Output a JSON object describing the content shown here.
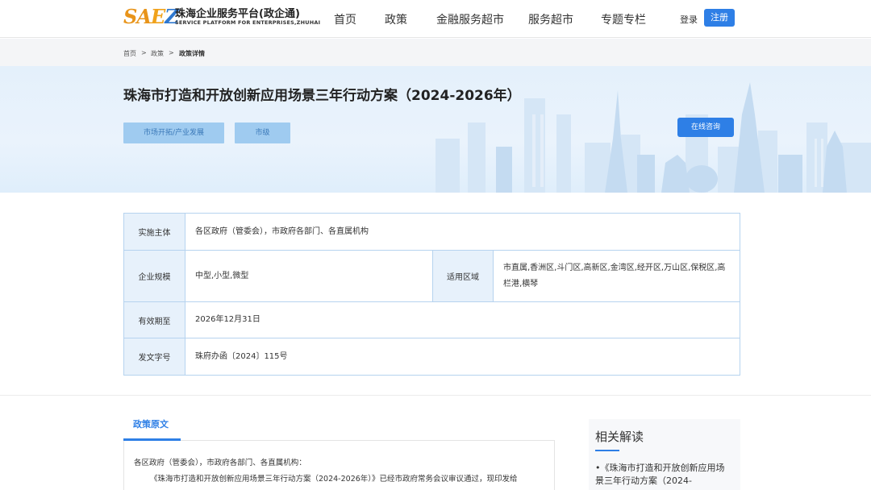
{
  "header": {
    "logo_mark": "SAEZ",
    "logo_cn": "珠海企业服务平台(政企通)",
    "logo_en": "SERVICE PLATFORM FOR ENTERPRISES,ZHUHAI",
    "nav": [
      "首页",
      "政策",
      "金融服务超市",
      "服务超市",
      "专题专栏"
    ],
    "login": "登录",
    "register": "注册"
  },
  "breadcrumb": {
    "items": [
      "首页",
      "政策",
      "政策详情"
    ],
    "separator": ">"
  },
  "banner": {
    "title": "珠海市打造和开放创新应用场景三年行动方案（2024-2026年）",
    "tags": [
      "市场开拓/产业发展",
      "市级"
    ],
    "consult_button": "在线咨询"
  },
  "info": {
    "implementer_label": "实施主体",
    "implementer_value": "各区政府（管委会），市政府各部门、各直属机构",
    "scale_label": "企业规模",
    "scale_value": "中型,小型,微型",
    "region_label": "适用区域",
    "region_value": "市直属,香洲区,斗门区,高新区,金湾区,经开区,万山区,保税区,高栏港,横琴",
    "validity_label": "有效期至",
    "validity_value": "2026年12月31日",
    "docno_label": "发文字号",
    "docno_value": "珠府办函〔2024〕115号"
  },
  "content": {
    "tab": "政策原文",
    "line1": "各区政府（管委会），市政府各部门、各直属机构：",
    "line2": "《珠海市打造和开放创新应用场景三年行动方案（2024-2026年）》已经市政府常务会议审议通过，现印发给"
  },
  "related": {
    "title": "相关解读",
    "items": [
      "•《珠海市打造和开放创新应用场景三年行动方案（2024-"
    ]
  },
  "colors": {
    "accent": "#2e7fe6",
    "tag_bg": "#9fcbf0",
    "table_border": "#b6d3ef",
    "label_bg": "#e7f1fb"
  }
}
